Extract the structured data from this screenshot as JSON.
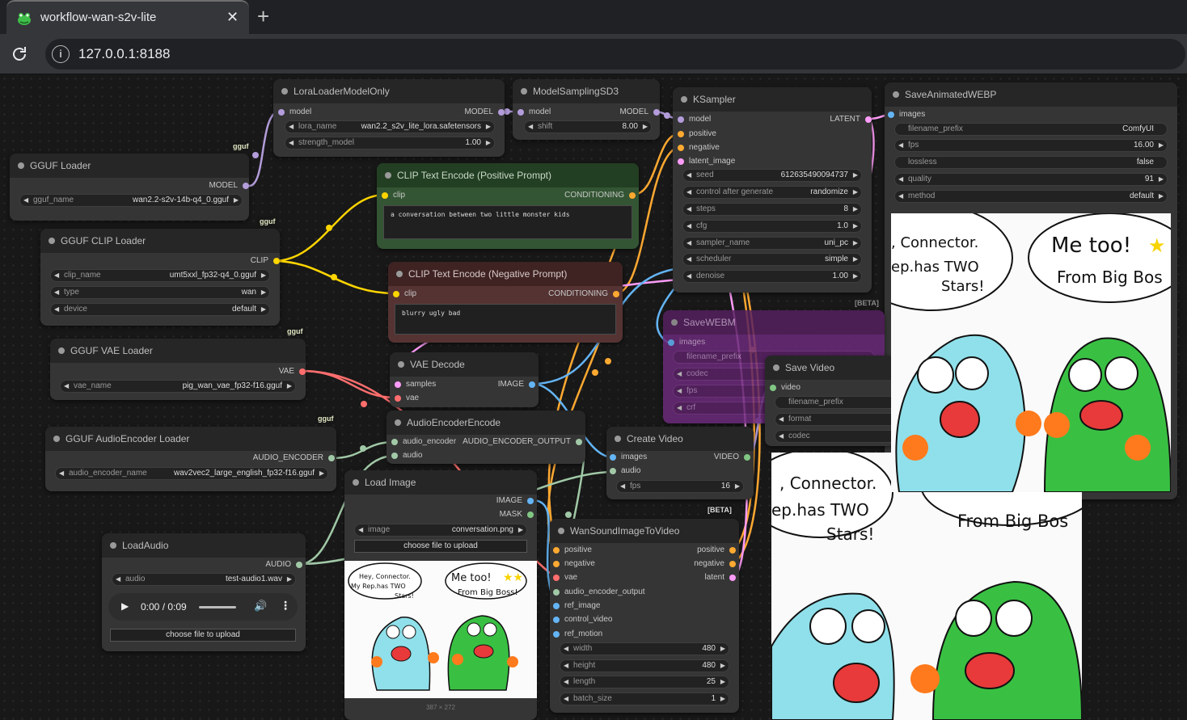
{
  "browser": {
    "tab_title": "workflow-wan-s2v-lite",
    "url": "127.0.0.1:8188"
  },
  "colors": {
    "model": "#b39ddb",
    "clip": "#ffd500",
    "conditioning": "#ffa931",
    "vae": "#ff6e6e",
    "latent": "#ff9cf9",
    "image": "#64b5f6",
    "audio": "#a1c9a7",
    "video": "#81c784"
  },
  "nodes": {
    "gguf_loader": {
      "title": "GGUF Loader",
      "out_model": "MODEL",
      "w_label": "gguf_name",
      "w_value": "wan2.2-s2v-14b-q4_0.gguf",
      "badge": "gguf"
    },
    "lora": {
      "title": "LoraLoaderModelOnly",
      "in_model": "model",
      "out_model": "MODEL",
      "w1_label": "lora_name",
      "w1_value": "wan2.2_s2v_lite_lora.safetensors",
      "w2_label": "strength_model",
      "w2_value": "1.00"
    },
    "msd3": {
      "title": "ModelSamplingSD3",
      "in_model": "model",
      "out_model": "MODEL",
      "w_label": "shift",
      "w_value": "8.00"
    },
    "ksampler": {
      "title": "KSampler",
      "in_model": "model",
      "in_pos": "positive",
      "in_neg": "negative",
      "in_latent": "latent_image",
      "out_latent": "LATENT",
      "seed_l": "seed",
      "seed_v": "612635490094737",
      "cag_l": "control after generate",
      "cag_v": "randomize",
      "steps_l": "steps",
      "steps_v": "8",
      "cfg_l": "cfg",
      "cfg_v": "1.0",
      "sampler_l": "sampler_name",
      "sampler_v": "uni_pc",
      "sched_l": "scheduler",
      "sched_v": "simple",
      "denoise_l": "denoise",
      "denoise_v": "1.00"
    },
    "save_webp": {
      "title": "SaveAnimatedWEBP",
      "in_images": "images",
      "fp_l": "filename_prefix",
      "fp_v": "ComfyUI",
      "fps_l": "fps",
      "fps_v": "16.00",
      "lossless_l": "lossless",
      "lossless_v": "false",
      "quality_l": "quality",
      "quality_v": "91",
      "method_l": "method",
      "method_v": "default"
    },
    "clip_loader": {
      "title": "GGUF CLIP Loader",
      "out_clip": "CLIP",
      "clip_l": "clip_name",
      "clip_v": "umt5xxl_fp32-q4_0.gguf",
      "type_l": "type",
      "type_v": "wan",
      "device_l": "device",
      "device_v": "default",
      "badge": "gguf"
    },
    "clip_pos": {
      "title": "CLIP Text Encode (Positive Prompt)",
      "in_clip": "clip",
      "out_cond": "CONDITIONING",
      "text": "a conversation between two little monster kids"
    },
    "clip_neg": {
      "title": "CLIP Text Encode (Negative Prompt)",
      "in_clip": "clip",
      "out_cond": "CONDITIONING",
      "text": "blurry ugly bad"
    },
    "vae_loader": {
      "title": "GGUF VAE Loader",
      "out_vae": "VAE",
      "w_label": "vae_name",
      "w_value": "pig_wan_vae_fp32-f16.gguf",
      "badge": "gguf"
    },
    "vae_decode": {
      "title": "VAE Decode",
      "in_samples": "samples",
      "in_vae": "vae",
      "out_image": "IMAGE"
    },
    "save_webm": {
      "title": "SaveWEBM",
      "in_images": "images",
      "fp_l": "filename_prefix",
      "codec_l": "codec",
      "fps_l": "fps",
      "crf_l": "crf",
      "beta": "[BETA]"
    },
    "save_video": {
      "title": "Save Video",
      "in_video": "video",
      "fp_l": "filename_prefix",
      "format_l": "format",
      "codec_l": "codec"
    },
    "audio_enc_loader": {
      "title": "GGUF AudioEncoder Loader",
      "out": "AUDIO_ENCODER",
      "w_label": "audio_encoder_name",
      "w_value": "wav2vec2_large_english_fp32-f16.gguf",
      "badge": "gguf"
    },
    "audio_enc_encode": {
      "title": "AudioEncoderEncode",
      "in_enc": "audio_encoder",
      "in_audio": "audio",
      "out": "AUDIO_ENCODER_OUTPUT"
    },
    "create_video": {
      "title": "Create Video",
      "in_images": "images",
      "in_audio": "audio",
      "out_video": "VIDEO",
      "fps_l": "fps",
      "fps_v": "16",
      "beta": "[BETA]"
    },
    "load_image": {
      "title": "Load Image",
      "out_image": "IMAGE",
      "out_mask": "MASK",
      "img_l": "image",
      "img_v": "conversation.png",
      "upload": "choose file to upload",
      "dims": "387 × 272"
    },
    "load_audio": {
      "title": "LoadAudio",
      "out_audio": "AUDIO",
      "audio_l": "audio",
      "audio_v": "test-audio1.wav",
      "player_time": "0:00 / 0:09",
      "upload": "choose file to upload"
    },
    "wan_s2v": {
      "title": "WanSoundImageToVideo",
      "in_pos": "positive",
      "in_neg": "negative",
      "in_vae": "vae",
      "in_aeo": "audio_encoder_output",
      "in_ref": "ref_image",
      "in_cv": "control_video",
      "in_rm": "ref_motion",
      "out_pos": "positive",
      "out_neg": "negative",
      "out_latent": "latent",
      "width_l": "width",
      "width_v": "480",
      "height_l": "height",
      "height_v": "480",
      "length_l": "length",
      "length_v": "25",
      "batch_l": "batch_size",
      "batch_v": "1"
    }
  },
  "comic": {
    "left_bubble": "Hey, Connector. My Rep. has TWO Stars!",
    "right_bubble": "Me too! From Big Boss!"
  }
}
